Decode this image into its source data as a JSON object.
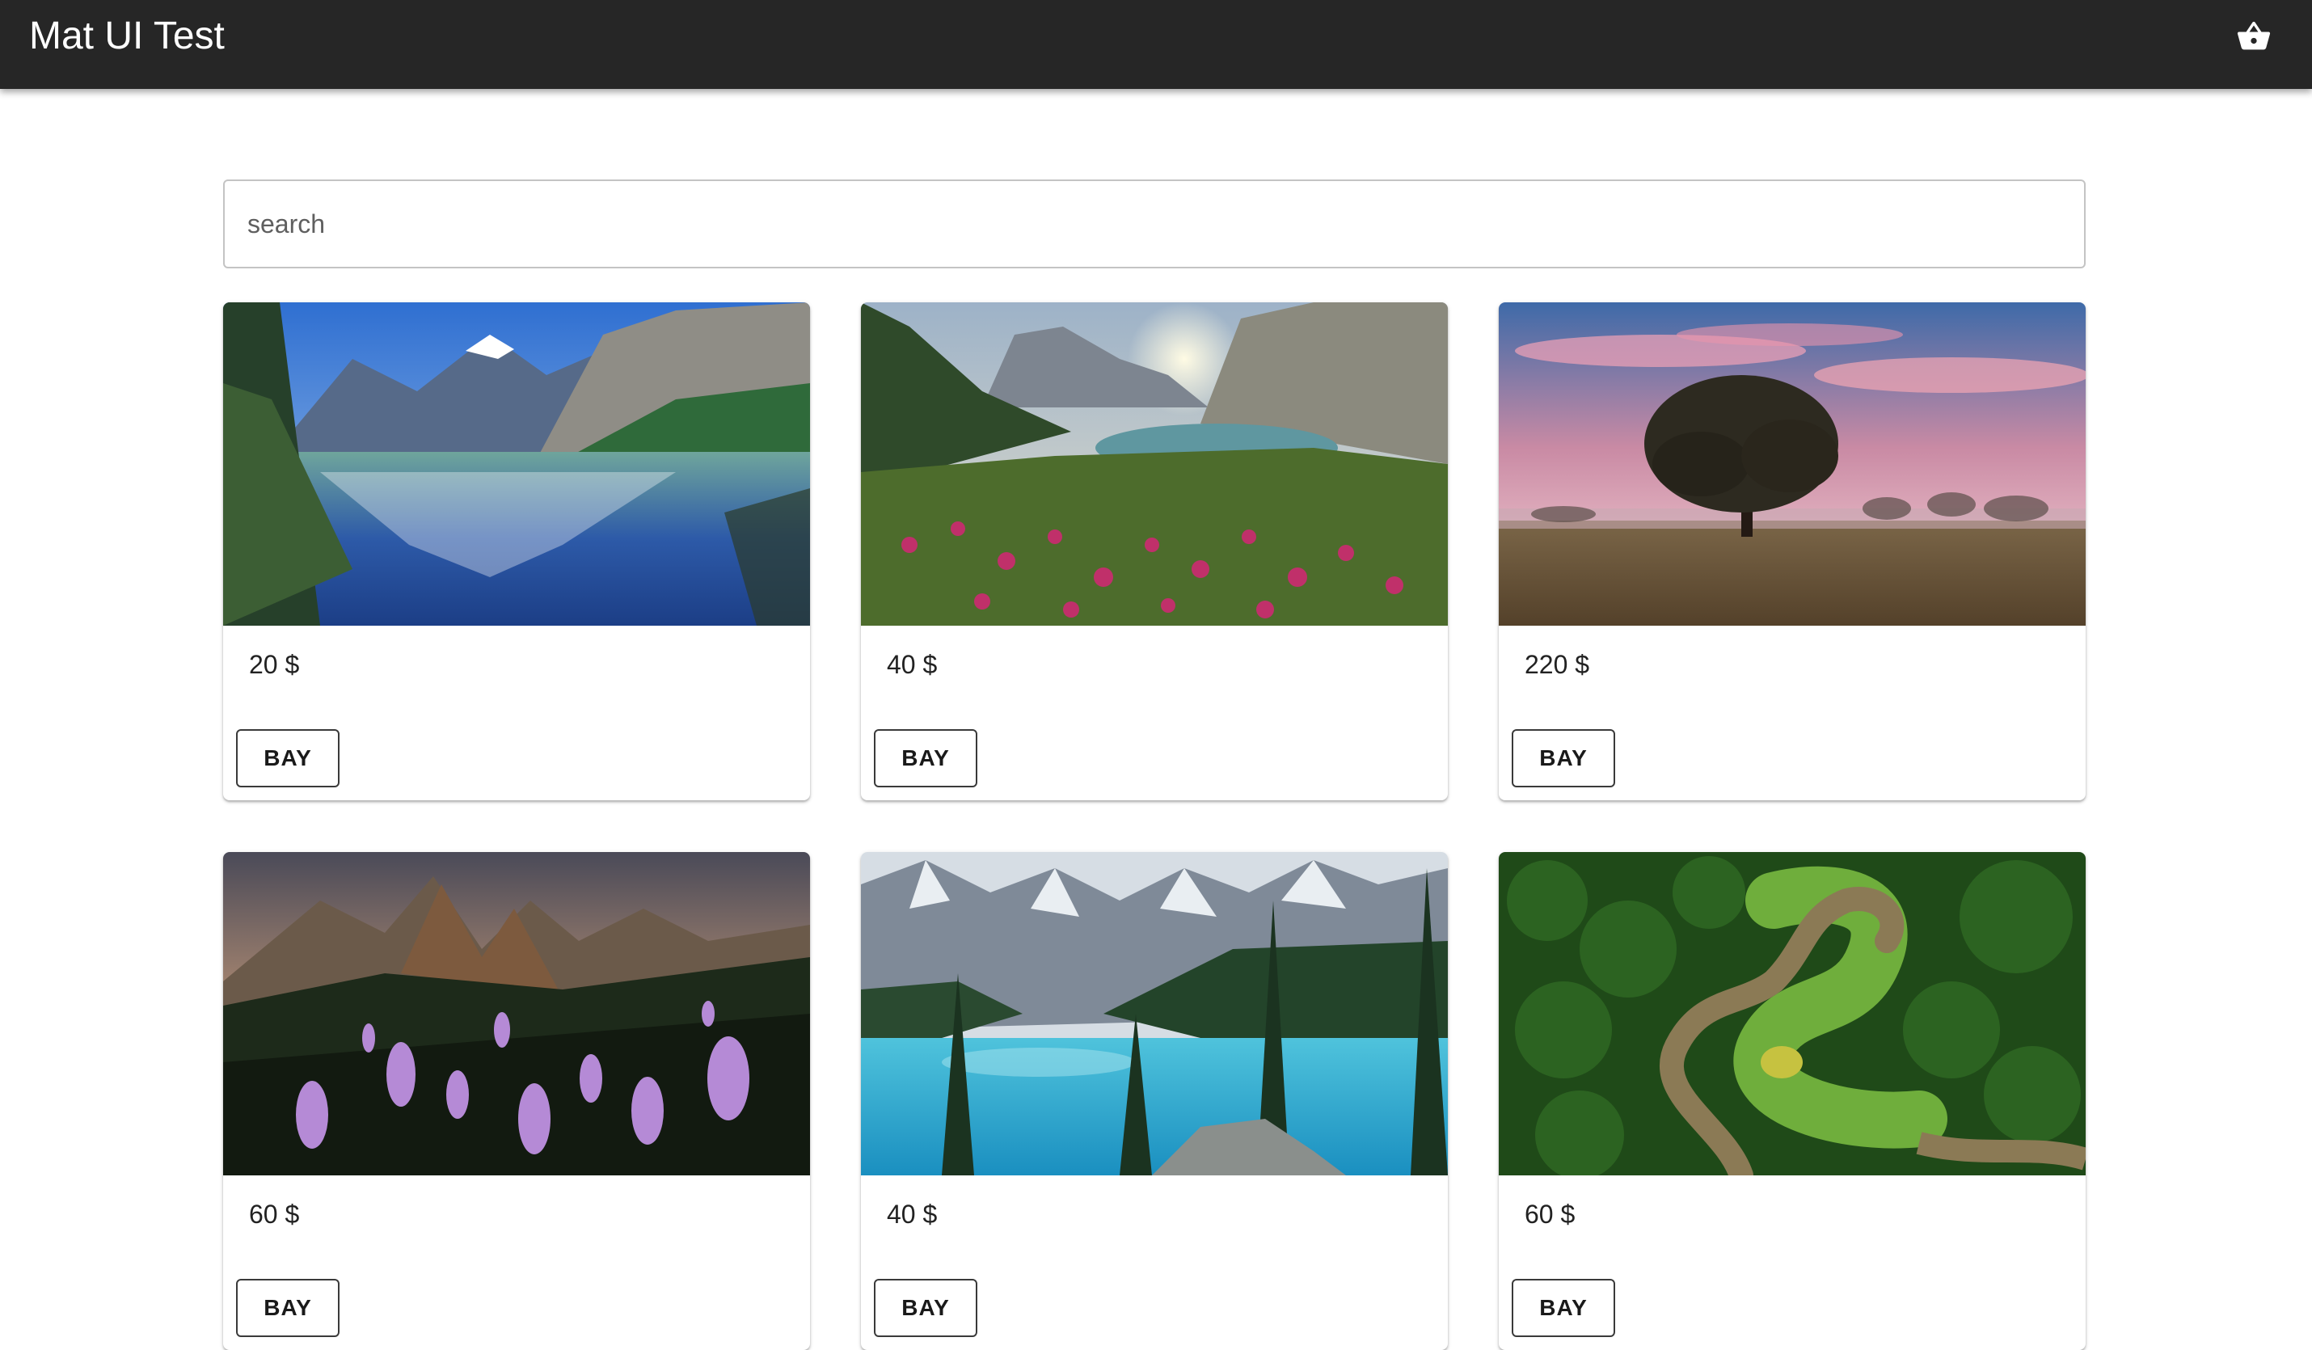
{
  "app": {
    "title": "Mat UI Test",
    "cart_icon": "shopping-basket-icon"
  },
  "search": {
    "placeholder": "search",
    "value": ""
  },
  "products": [
    {
      "price": "20 $",
      "buy_label": "BAY",
      "image": "mountain-lake-reflection"
    },
    {
      "price": "40 $",
      "buy_label": "BAY",
      "image": "alpine-sunrise-flowers"
    },
    {
      "price": "220 $",
      "buy_label": "BAY",
      "image": "lone-tree-pink-sky"
    },
    {
      "price": "60 $",
      "buy_label": "BAY",
      "image": "purple-wildflowers-peaks"
    },
    {
      "price": "40 $",
      "buy_label": "BAY",
      "image": "turquoise-lake-forest"
    },
    {
      "price": "60 $",
      "buy_label": "BAY",
      "image": "river-bend-aerial"
    }
  ],
  "colors": {
    "appbar": "#262626",
    "button_border": "#3a3a3a"
  }
}
